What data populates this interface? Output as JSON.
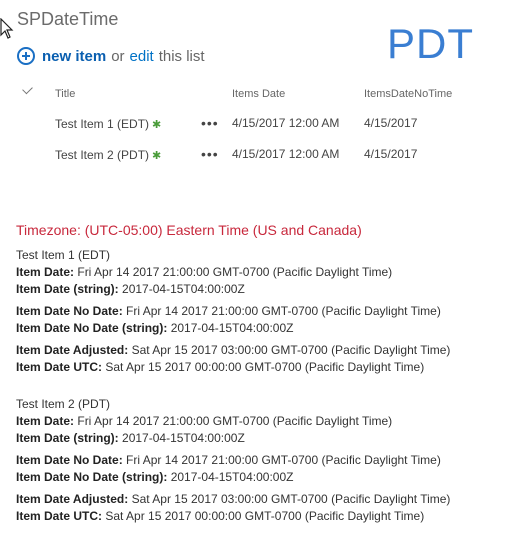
{
  "site_title": "SPDateTime",
  "timezone_badge": "PDT",
  "actions": {
    "new_item": "new item",
    "or": "or",
    "edit": "edit",
    "this_list": "this list"
  },
  "columns": [
    "Title",
    "Items Date",
    "ItemsDateNoTime"
  ],
  "rows": [
    {
      "title": "Test Item 1 (EDT)",
      "items_date": "4/15/2017 12:00 AM",
      "items_date_no_time": "4/15/2017"
    },
    {
      "title": "Test Item 2 (PDT)",
      "items_date": "4/15/2017 12:00 AM",
      "items_date_no_time": "4/15/2017"
    }
  ],
  "timezone_heading": "Timezone: (UTC-05:00) Eastern Time (US and Canada)",
  "details": [
    {
      "name": "Test Item 1 (EDT)",
      "fields": [
        {
          "label": "Item Date:",
          "value": "Fri Apr 14 2017 21:00:00 GMT-0700 (Pacific Daylight Time)"
        },
        {
          "label": "Item Date (string):",
          "value": "2017-04-15T04:00:00Z"
        },
        {
          "label": "Item Date No Date:",
          "value": "Fri Apr 14 2017 21:00:00 GMT-0700 (Pacific Daylight Time)"
        },
        {
          "label": "Item Date No Date (string):",
          "value": "2017-04-15T04:00:00Z"
        },
        {
          "label": "Item Date Adjusted:",
          "value": "Sat Apr 15 2017 03:00:00 GMT-0700 (Pacific Daylight Time)"
        },
        {
          "label": "Item Date UTC:",
          "value": "Sat Apr 15 2017 00:00:00 GMT-0700 (Pacific Daylight Time)"
        }
      ]
    },
    {
      "name": "Test Item 2 (PDT)",
      "fields": [
        {
          "label": "Item Date:",
          "value": "Fri Apr 14 2017 21:00:00 GMT-0700 (Pacific Daylight Time)"
        },
        {
          "label": "Item Date (string):",
          "value": "2017-04-15T04:00:00Z"
        },
        {
          "label": "Item Date No Date:",
          "value": "Fri Apr 14 2017 21:00:00 GMT-0700 (Pacific Daylight Time)"
        },
        {
          "label": "Item Date No Date (string):",
          "value": "2017-04-15T04:00:00Z"
        },
        {
          "label": "Item Date Adjusted:",
          "value": "Sat Apr 15 2017 03:00:00 GMT-0700 (Pacific Daylight Time)"
        },
        {
          "label": "Item Date UTC:",
          "value": "Sat Apr 15 2017 00:00:00 GMT-0700 (Pacific Daylight Time)"
        }
      ]
    }
  ]
}
